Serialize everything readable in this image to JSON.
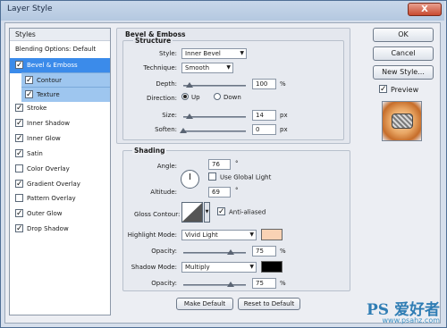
{
  "window": {
    "title": "Layer Style",
    "close_glyph": "X"
  },
  "sidebar": {
    "header": "Styles",
    "items": [
      {
        "label": "Blending Options: Default",
        "checkbox": false
      },
      {
        "label": "Bevel & Emboss",
        "checked": true,
        "selected": true
      },
      {
        "label": "Contour",
        "checked": true,
        "sub": true
      },
      {
        "label": "Texture",
        "checked": true,
        "sub": true
      },
      {
        "label": "Stroke",
        "checked": true
      },
      {
        "label": "Inner Shadow",
        "checked": true
      },
      {
        "label": "Inner Glow",
        "checked": true
      },
      {
        "label": "Satin",
        "checked": true
      },
      {
        "label": "Color Overlay",
        "checked": false
      },
      {
        "label": "Gradient Overlay",
        "checked": true
      },
      {
        "label": "Pattern Overlay",
        "checked": false
      },
      {
        "label": "Outer Glow",
        "checked": true
      },
      {
        "label": "Drop Shadow",
        "checked": true
      }
    ]
  },
  "bevel": {
    "group_title": "Bevel & Emboss",
    "structure_title": "Structure",
    "style_label": "Style:",
    "style_value": "Inner Bevel",
    "technique_label": "Technique:",
    "technique_value": "Smooth",
    "depth_label": "Depth:",
    "depth_value": "100",
    "depth_unit": "%",
    "depth_level": 0.1,
    "direction_label": "Direction:",
    "up_label": "Up",
    "down_label": "Down",
    "direction_value": "Up",
    "size_label": "Size:",
    "size_value": "14",
    "size_unit": "px",
    "size_level": 0.1,
    "soften_label": "Soften:",
    "soften_value": "0",
    "soften_unit": "px",
    "soften_level": 0
  },
  "shading": {
    "title": "Shading",
    "angle_label": "Angle:",
    "angle_value": "76",
    "angle_unit": "°",
    "global_light_label": "Use Global Light",
    "global_light_checked": false,
    "altitude_label": "Altitude:",
    "altitude_value": "69",
    "altitude_unit": "°",
    "gloss_label": "Gloss Contour:",
    "antialias_label": "Anti-aliased",
    "antialias_checked": true,
    "highlight_label": "Highlight Mode:",
    "highlight_value": "Vivid Light",
    "highlight_color": "#f9d2b4",
    "hl_opacity_label": "Opacity:",
    "hl_opacity_value": "75",
    "hl_opacity_unit": "%",
    "hl_opacity_level": 0.75,
    "shadow_label": "Shadow Mode:",
    "shadow_value": "Multiply",
    "shadow_color": "#000000",
    "sh_opacity_label": "Opacity:",
    "sh_opacity_value": "75",
    "sh_opacity_unit": "%",
    "sh_opacity_level": 0.75
  },
  "footer": {
    "make_default": "Make Default",
    "reset_default": "Reset to Default"
  },
  "actions": {
    "ok": "OK",
    "cancel": "Cancel",
    "new_style": "New Style...",
    "preview_label": "Preview",
    "preview_checked": true
  },
  "watermark": {
    "text": "PS 爱好者",
    "sub": "www.psahz.com"
  }
}
